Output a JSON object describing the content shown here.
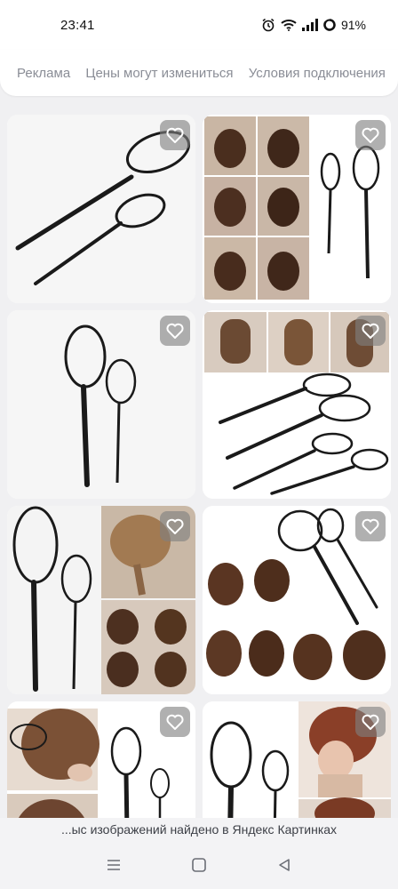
{
  "status_bar": {
    "time": "23:41",
    "battery": "91%",
    "icons": [
      "alarm-icon",
      "wifi-icon",
      "signal-icon",
      "battery-icon"
    ]
  },
  "chips": [
    "Реклама",
    "Цены могут измениться",
    "Условия подключения"
  ],
  "grid": {
    "cards": [
      {
        "name": "black hair loop tools"
      },
      {
        "name": "hair loop tools with hairstyle steps"
      },
      {
        "name": "two black topsy tail loops"
      },
      {
        "name": "ponytail hairstyles with loop tools"
      },
      {
        "name": "black loops with braided hair"
      },
      {
        "name": "updo hairstyles with loop tools"
      },
      {
        "name": "loop tool used on hair"
      },
      {
        "name": "loops with curly updo"
      }
    ],
    "favorite_icon": "heart-icon"
  },
  "footer": {
    "text": "...ыс изображений найдено в Яндекс Картинках"
  },
  "nav": {
    "icons": [
      "menu-icon",
      "home-icon",
      "back-icon"
    ]
  }
}
